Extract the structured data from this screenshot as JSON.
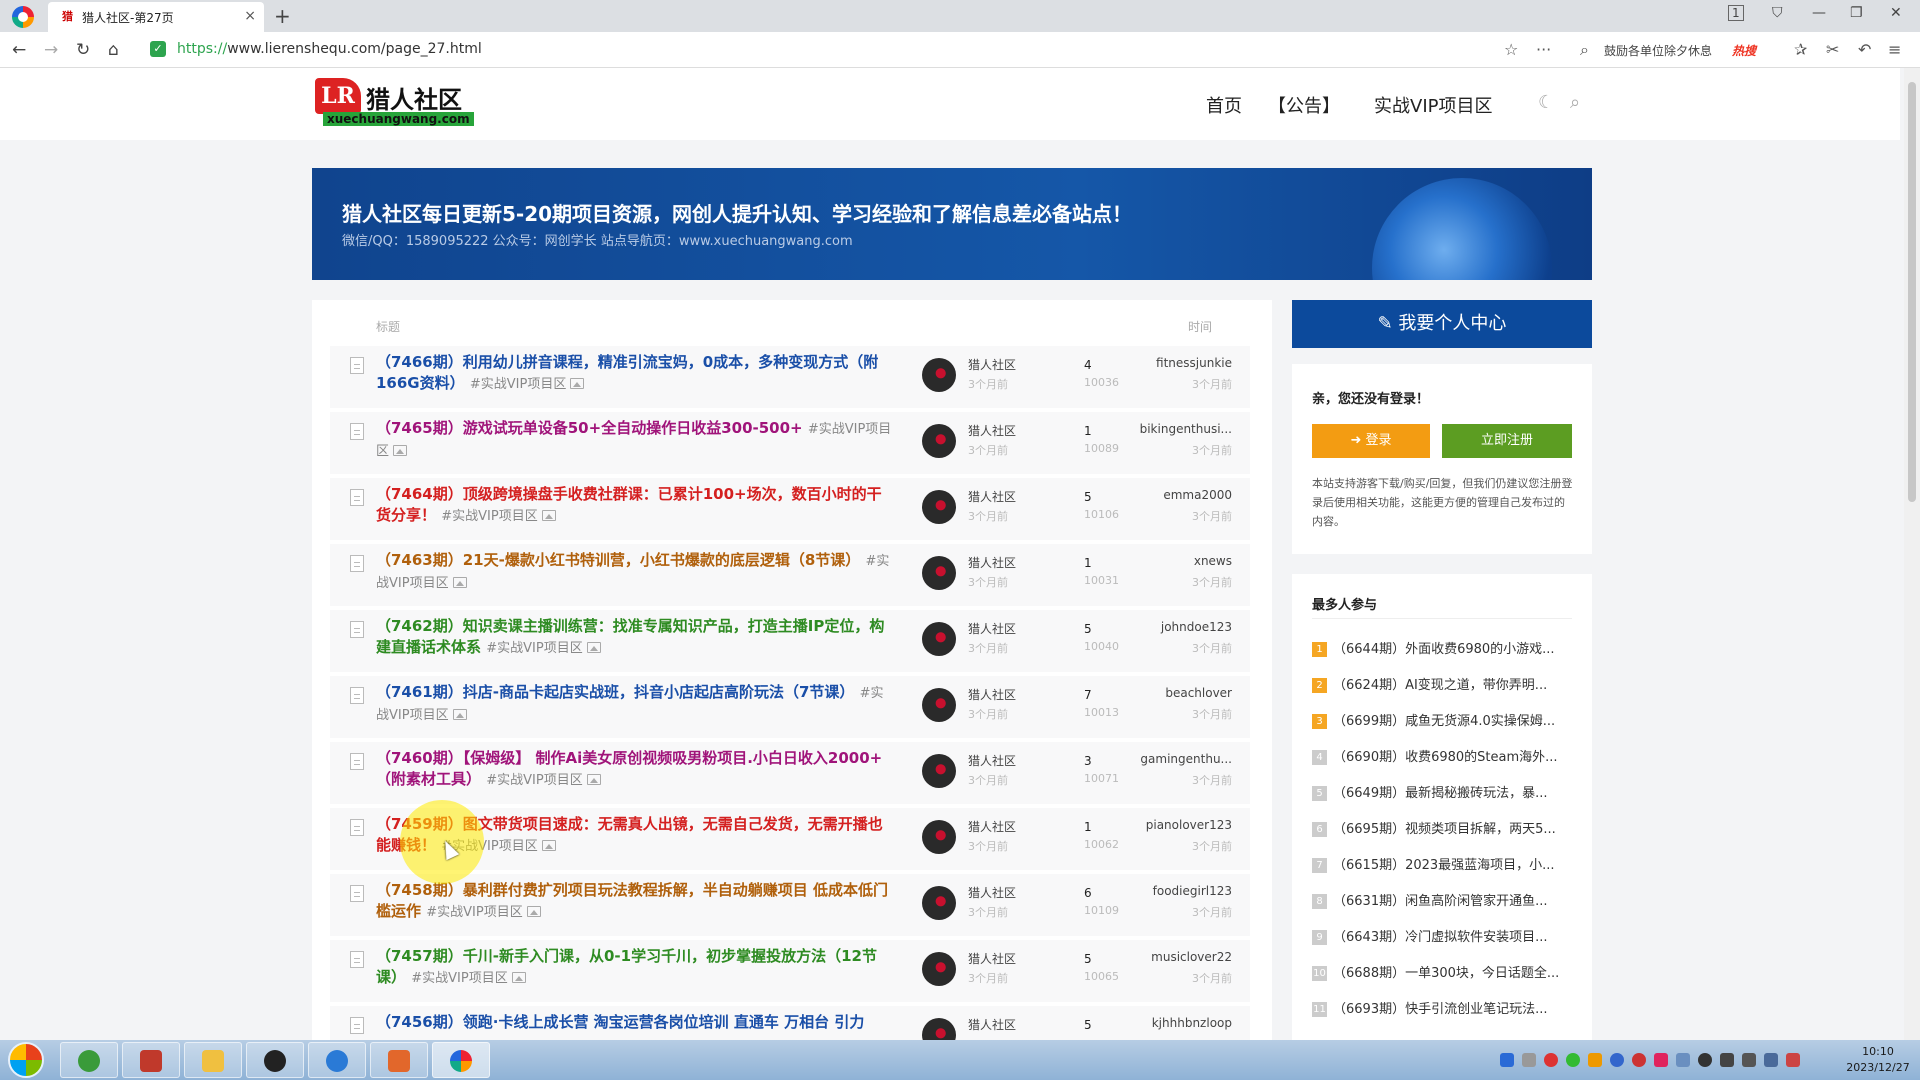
{
  "browser": {
    "tab_title": "猎人社区-第27页",
    "url_protocol": "https://",
    "url_rest": "www.lierenshequ.com/page_27.html",
    "search_hint": "鼓励各单位除夕休息",
    "search_hot": "热搜",
    "tab_counter": "1"
  },
  "site": {
    "logo_mark": "LR",
    "logo_name": "猎人社区",
    "logo_sub": "xuechuangwang.com",
    "nav": [
      "首页",
      "【公告】",
      "实战VIP项目区"
    ]
  },
  "banner": {
    "title": "猎人社区每日更新5-20期项目资源，网创人提升认知、学习经验和了解信息差必备站点！",
    "subtitle": "微信/QQ：1589095222 公众号：网创学长 站点导航页：www.xuechuangwang.com"
  },
  "list": {
    "header_title": "标题",
    "header_time": "时间",
    "rows": [
      {
        "title": "（7466期）利用幼儿拼音课程，精准引流宝妈，0成本，多种变现方式（附166G资料）",
        "tag": "#实战VIP项目区",
        "color": "#1a4fa8",
        "author": "猎人社区",
        "ago": "3个月前",
        "replies": "4",
        "views": "10036",
        "user": "fitnessjunkie",
        "user_ago": "3个月前"
      },
      {
        "title": "（7465期）游戏试玩单设备50+全自动操作日收益300-500+",
        "tag": "#实战VIP项目区",
        "color": "#a0147a",
        "author": "猎人社区",
        "ago": "3个月前",
        "replies": "1",
        "views": "10089",
        "user": "bikingenthusi...",
        "user_ago": "3个月前"
      },
      {
        "title": "（7464期）顶级跨境操盘手收费社群课：已累计100+场次，数百小时的干货分享！",
        "tag": "#实战VIP项目区",
        "color": "#d42020",
        "author": "猎人社区",
        "ago": "3个月前",
        "replies": "5",
        "views": "10106",
        "user": "emma2000",
        "user_ago": "3个月前"
      },
      {
        "title": "（7463期）21天-爆款小红书特训营，小红书爆款的底层逻辑（8节课）",
        "tag": "#实战VIP项目区",
        "color": "#b0600c",
        "author": "猎人社区",
        "ago": "3个月前",
        "replies": "1",
        "views": "10031",
        "user": "xnews",
        "user_ago": "3个月前"
      },
      {
        "title": "（7462期）知识卖课主播训练营：找准专属知识产品，打造主播IP定位，构建直播话术体系",
        "tag": "#实战VIP项目区",
        "color": "#2e8b22",
        "author": "猎人社区",
        "ago": "3个月前",
        "replies": "5",
        "views": "10040",
        "user": "johndoe123",
        "user_ago": "3个月前"
      },
      {
        "title": "（7461期）抖店-商品卡起店实战班，抖音小店起店高阶玩法（7节课）",
        "tag": "#实战VIP项目区",
        "color": "#1a4fa8",
        "author": "猎人社区",
        "ago": "3个月前",
        "replies": "7",
        "views": "10013",
        "user": "beachlover",
        "user_ago": "3个月前"
      },
      {
        "title": "（7460期）【保姆级】 制作Ai美女原创视频吸男粉项目.小白日收入2000+（附素材工具）",
        "tag": "#实战VIP项目区",
        "color": "#a0147a",
        "author": "猎人社区",
        "ago": "3个月前",
        "replies": "3",
        "views": "10071",
        "user": "gamingenthu...",
        "user_ago": "3个月前"
      },
      {
        "title": "（7459期）图文带货项目速成：无需真人出镜，无需自己发货，无需开播也能赚钱！",
        "tag": "#实战VIP项目区",
        "color": "#d42020",
        "author": "猎人社区",
        "ago": "3个月前",
        "replies": "1",
        "views": "10062",
        "user": "pianolover123",
        "user_ago": "3个月前"
      },
      {
        "title": "（7458期）暴利群付费扩列项目玩法教程拆解，半自动躺赚项目 低成本低门槛运作",
        "tag": "#实战VIP项目区",
        "color": "#b0600c",
        "author": "猎人社区",
        "ago": "3个月前",
        "replies": "6",
        "views": "10109",
        "user": "foodiegirl123",
        "user_ago": "3个月前"
      },
      {
        "title": "（7457期）千川-新手入门课，从0-1学习千川，初步掌握投放方法（12节课）",
        "tag": "#实战VIP项目区",
        "color": "#2e8b22",
        "author": "猎人社区",
        "ago": "3个月前",
        "replies": "5",
        "views": "10065",
        "user": "musiclover22",
        "user_ago": "3个月前"
      },
      {
        "title": "（7456期）领跑·卡线上成长营 淘宝运营各岗位培训 直通车 万相台 引力",
        "tag": "",
        "color": "#1a4fa8",
        "author": "猎人社区",
        "ago": "",
        "replies": "5",
        "views": "",
        "user": "kjhhhbnzloop",
        "user_ago": ""
      }
    ]
  },
  "sidebar": {
    "member_center": "我要个人中心",
    "login_prompt": "亲，您还没有登录！",
    "login_btn": "登录",
    "register_btn": "立即注册",
    "login_note": "本站支持游客下载/购买/回复，但我们仍建议您注册登录后使用相关功能，这能更方便的管理自己发布过的内容。",
    "hot_title": "最多人参与",
    "hot_items": [
      {
        "rank": "1",
        "text": "（6644期）外面收费6980的小游戏..."
      },
      {
        "rank": "2",
        "text": "（6624期）AI变现之道，带你弄明..."
      },
      {
        "rank": "3",
        "text": "（6699期）咸鱼无货源4.0实操保姆..."
      },
      {
        "rank": "4",
        "text": "（6690期）收费6980的Steam海外..."
      },
      {
        "rank": "5",
        "text": "（6649期）最新揭秘搬砖玩法，暴..."
      },
      {
        "rank": "6",
        "text": "（6695期）视频类项目拆解，两天5..."
      },
      {
        "rank": "7",
        "text": "（6615期）2023最强蓝海项目，小..."
      },
      {
        "rank": "8",
        "text": "（6631期）闲鱼高阶闲管家开通鱼..."
      },
      {
        "rank": "9",
        "text": "（6643期）冷门虚拟软件安装项目..."
      },
      {
        "rank": "10",
        "text": "（6688期）一单300块，今日话题全..."
      },
      {
        "rank": "11",
        "text": "（6693期）快手引流创业笔记玩法..."
      }
    ]
  },
  "taskbar": {
    "time": "10:10",
    "date": "2023/12/27"
  }
}
